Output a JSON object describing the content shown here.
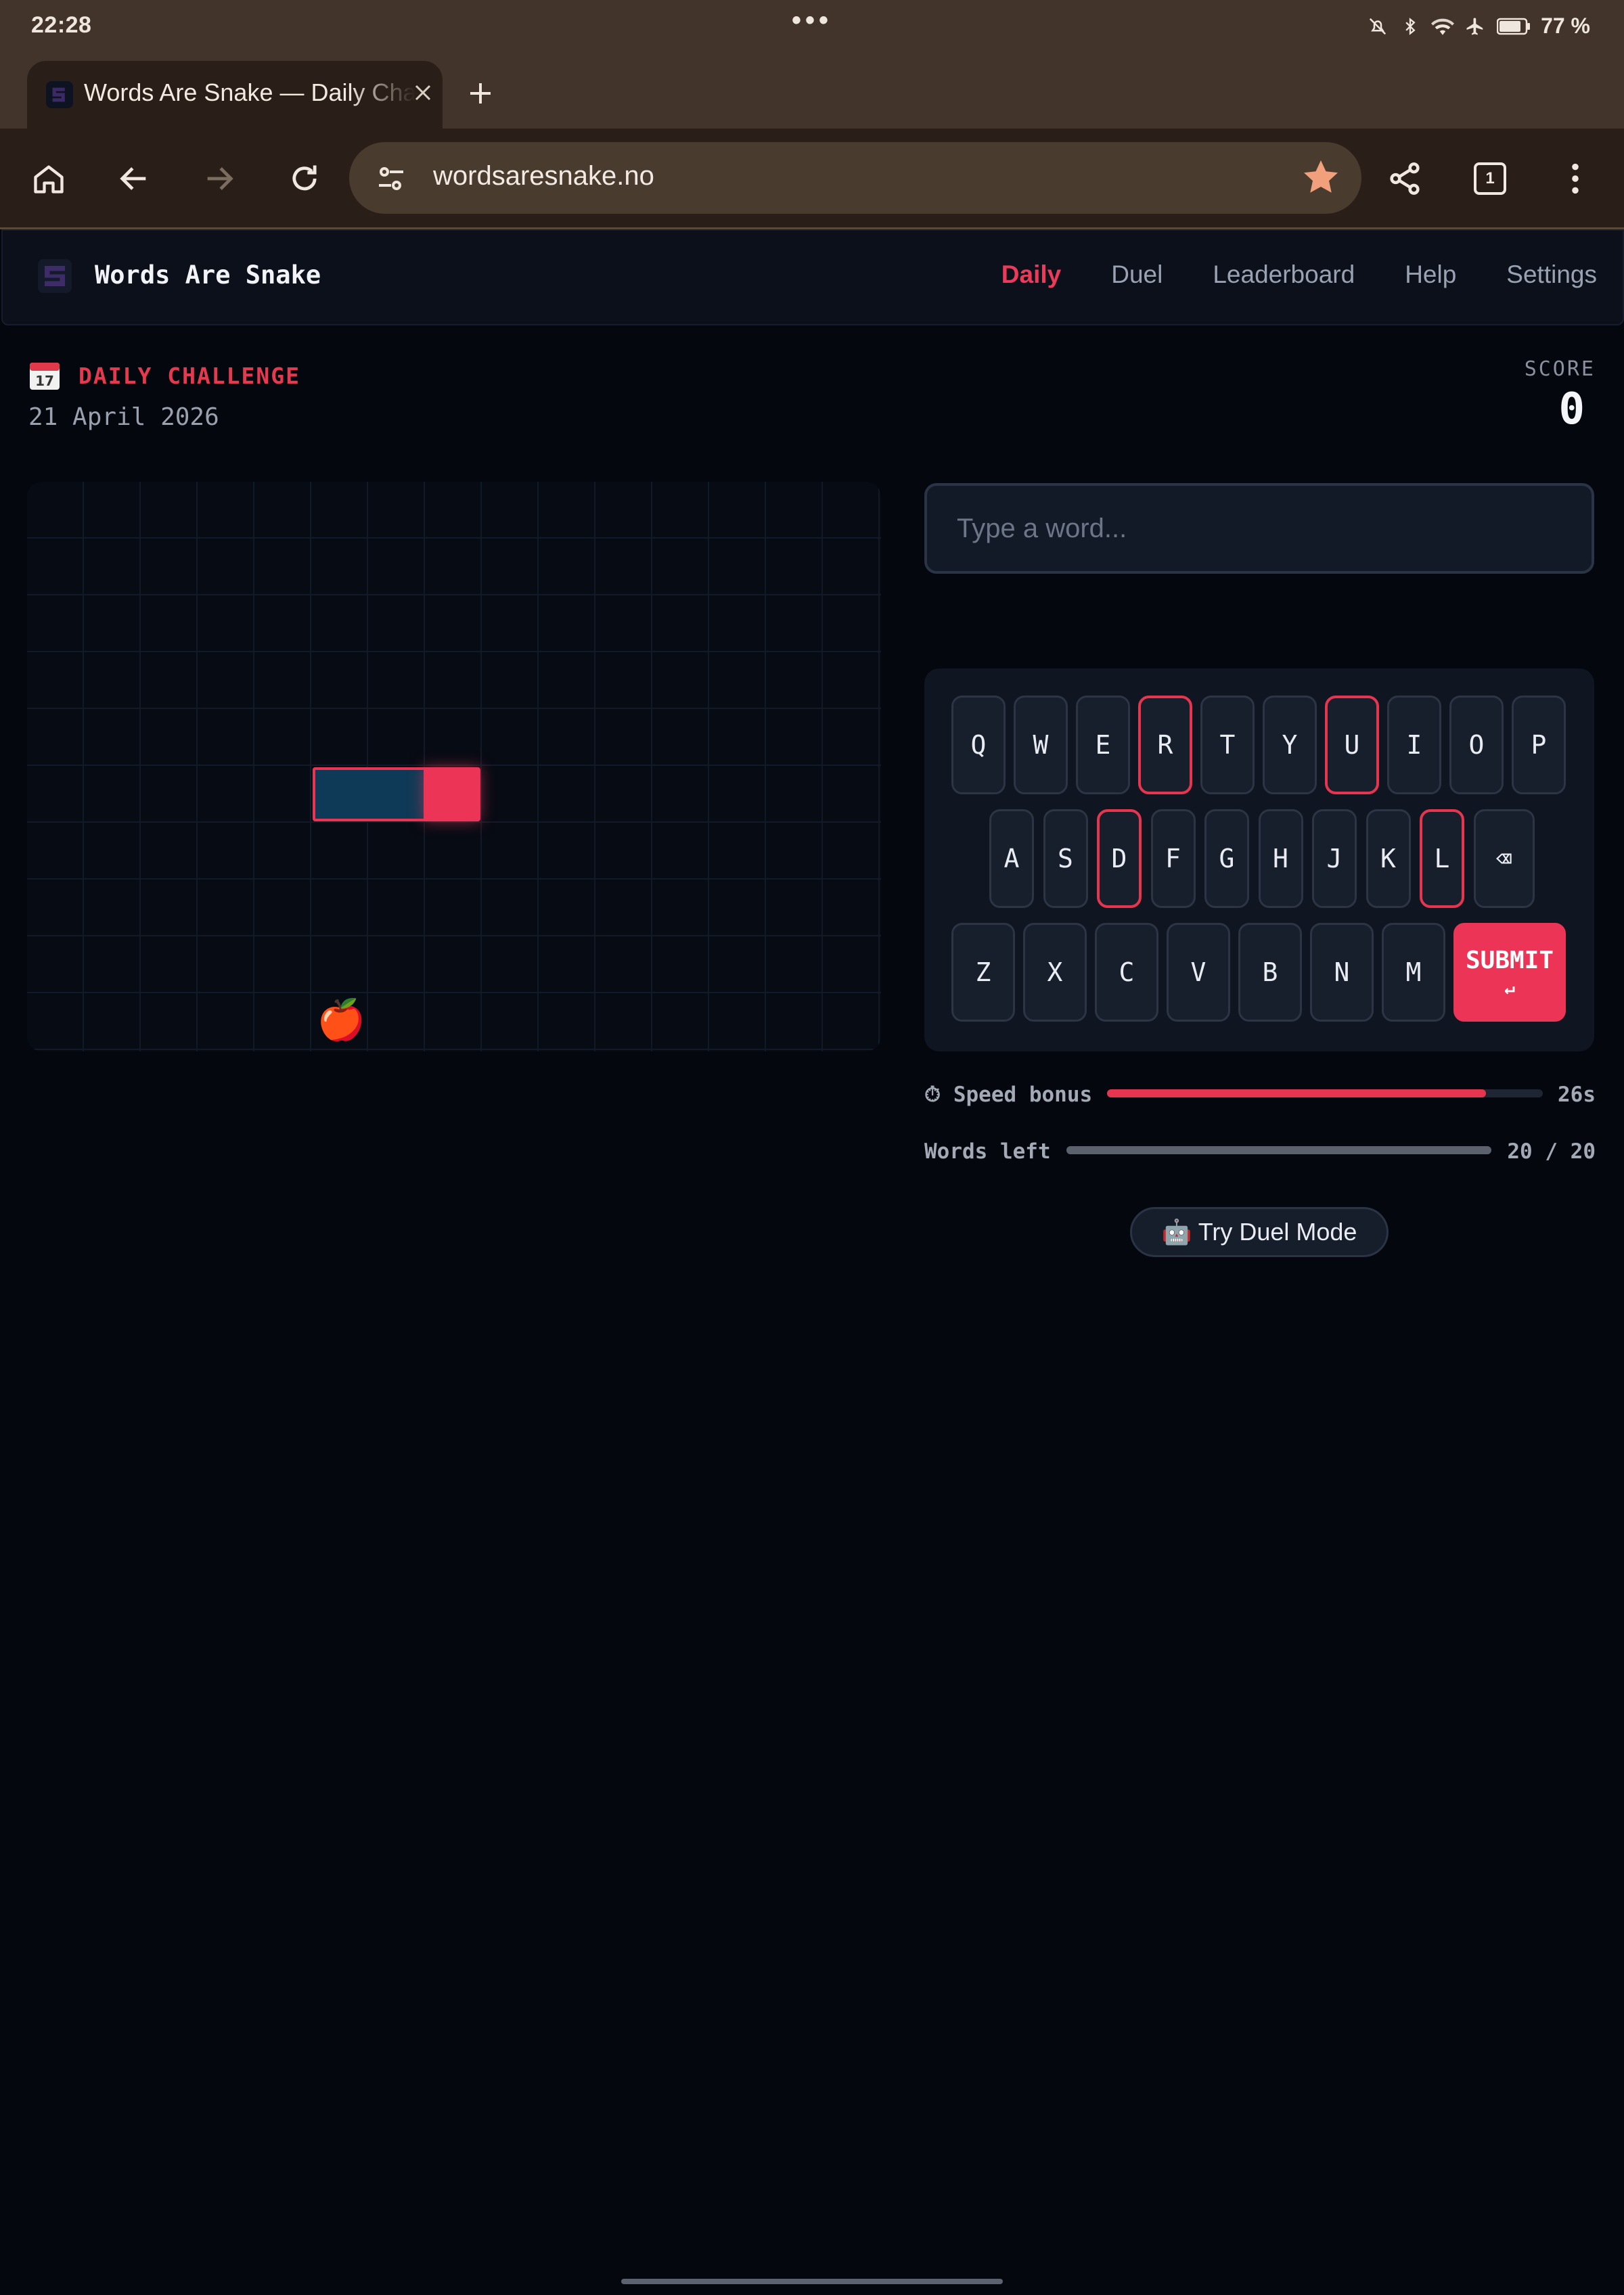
{
  "status_bar": {
    "time": "22:28",
    "battery": "77 %",
    "icons": [
      "bell-off-icon",
      "bluetooth-icon",
      "wifi-icon",
      "airplane-icon",
      "battery-icon"
    ]
  },
  "browser": {
    "tab_title": "Words Are Snake — Daily Challenge",
    "url": "wordsaresnake.no",
    "tab_count": "1",
    "accent_star": "#f0a080"
  },
  "site": {
    "brand": "Words Are Snake",
    "nav": [
      "Daily",
      "Duel",
      "Leaderboard",
      "Help",
      "Settings"
    ],
    "active_nav": "Daily",
    "accent": "#ec3556"
  },
  "game": {
    "mode_label": "DAILY CHALLENGE",
    "date": "21 April 2026",
    "score_label": "SCORE",
    "score": "0",
    "apple": "🍎",
    "input_placeholder": "Type a word...",
    "keyboard": {
      "row1": [
        "Q",
        "W",
        "E",
        "R",
        "T",
        "Y",
        "U",
        "I",
        "O",
        "P"
      ],
      "row2": [
        "A",
        "S",
        "D",
        "F",
        "G",
        "H",
        "J",
        "K",
        "L",
        "⌫"
      ],
      "row3": [
        "Z",
        "X",
        "C",
        "V",
        "B",
        "N",
        "M"
      ],
      "submit_label": "SUBMIT",
      "submit_arrow": "↵",
      "used_keys": [
        "R",
        "U",
        "D",
        "L"
      ]
    },
    "speed_bonus": {
      "label": "⏱ Speed bonus",
      "value": "26s",
      "fraction": 0.87
    },
    "words_left": {
      "label": "Words left",
      "value": "20 / 20",
      "fraction": 1.0
    },
    "duel_button": "🤖 Try Duel Mode"
  }
}
